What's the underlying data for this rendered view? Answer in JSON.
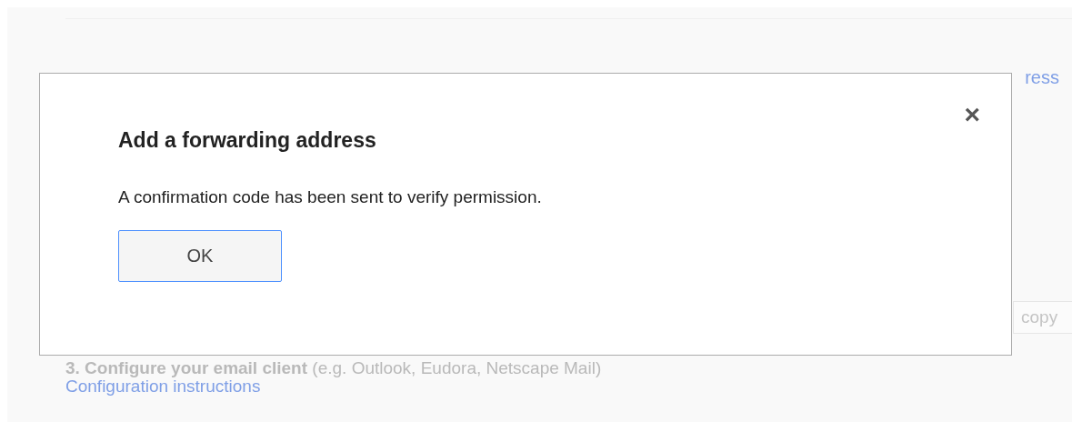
{
  "background": {
    "top_link_fragment": "ress",
    "field_fragment": "copy",
    "step": "**3. Configure your email client** (e.g. Outlook, Eudora, Netscape Mail)",
    "link": "Configuration instructions"
  },
  "dialog": {
    "title": "Add a forwarding address",
    "message": "A confirmation code has been sent to verify permission.",
    "close": "×",
    "buttons": [
      "OK"
    ]
  }
}
